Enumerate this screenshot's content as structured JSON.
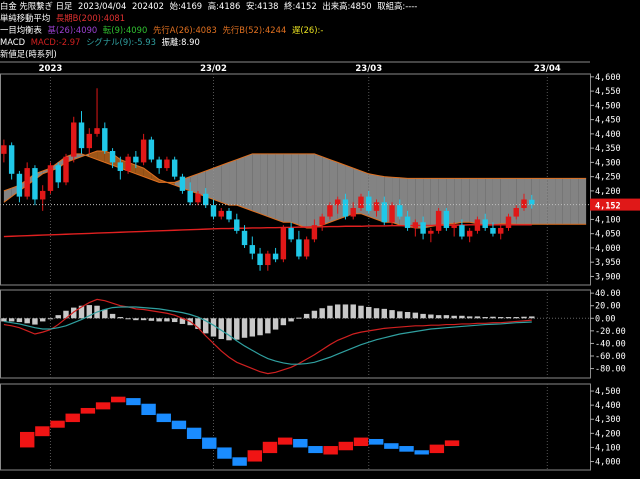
{
  "header": {
    "line1": {
      "instrument": "白金 先限繋ぎ 日足",
      "date": "2023/04/04",
      "contract": "202402",
      "open": "始:4169",
      "high": "高:4186",
      "low": "安:4138",
      "close": "終:4152",
      "volume": "出来高:4850",
      "turnover": "取組高:----"
    },
    "line2": {
      "label": "単純移動平均",
      "ma": "長期B(200):4081",
      "ma_color": "#e03030"
    },
    "line3": {
      "label": "一目均衡表",
      "base": "基(26):4090",
      "base_color": "#9a40d0",
      "conv": "転(9):4090",
      "conv_color": "#30c030",
      "spanA": "先行A(26):4083",
      "spanA_color": "#e07020",
      "spanB": "先行B(52):4244",
      "spanB_color": "#e07020",
      "lag": "遅(26):-",
      "lag_color": "#e8e020"
    },
    "line4": {
      "label": "MACD",
      "macd": "MACD:-2.97",
      "macd_color": "#d02020",
      "signal": "シグナル(9):-5.93",
      "signal_color": "#30a0a0",
      "osc": "振離:8.90"
    },
    "line5": {
      "label": "新値足(時系列)"
    }
  },
  "date_axis": [
    {
      "label": "2023",
      "bar": 6
    },
    {
      "label": "23/02",
      "bar": 27
    },
    {
      "label": "23/03",
      "bar": 47
    },
    {
      "label": "23/04",
      "bar": 70
    }
  ],
  "panels": {
    "price": {
      "ticks": [
        "4,600",
        "4,550",
        "4,500",
        "4,450",
        "4,400",
        "4,350",
        "4,300",
        "4,250",
        "4,200",
        "4,150",
        "4,100",
        "4,050",
        "4,000",
        "3,950",
        "3,900"
      ],
      "current_label": "4,152",
      "current_value": 4152
    },
    "macd": {
      "ticks": [
        "40.00",
        "20.00",
        "0.00",
        "-20.00",
        "-40.00",
        "-60.00",
        "-80.00"
      ]
    },
    "shinne": {
      "ticks": [
        "4,500",
        "4,400",
        "4,300",
        "4,200",
        "4,100",
        "4,000"
      ]
    }
  },
  "colors": {
    "up": "#e01818",
    "down": "#20c8e8",
    "cloud_up": "#b8651c",
    "cloud_down": "#9a9a9a",
    "osc": "#c8c8c8",
    "blue": "#1a8cff",
    "red": "#f01414"
  },
  "chart_data": [
    {
      "type": "candlestick",
      "title": "白金 先限繋ぎ 日足",
      "y_range": [
        3870,
        4610
      ],
      "ohlc": [
        [
          4330,
          4380,
          4300,
          4360
        ],
        [
          4360,
          4370,
          4240,
          4260
        ],
        [
          4260,
          4270,
          4160,
          4180
        ],
        [
          4180,
          4300,
          4170,
          4280
        ],
        [
          4280,
          4290,
          4150,
          4170
        ],
        [
          4170,
          4220,
          4130,
          4200
        ],
        [
          4200,
          4300,
          4190,
          4290
        ],
        [
          4290,
          4300,
          4210,
          4230
        ],
        [
          4230,
          4330,
          4220,
          4320
        ],
        [
          4320,
          4460,
          4300,
          4440
        ],
        [
          4440,
          4480,
          4330,
          4350
        ],
        [
          4350,
          4420,
          4330,
          4400
        ],
        [
          4400,
          4560,
          4390,
          4420
        ],
        [
          4420,
          4440,
          4330,
          4340
        ],
        [
          4340,
          4350,
          4280,
          4300
        ],
        [
          4300,
          4320,
          4240,
          4270
        ],
        [
          4270,
          4330,
          4260,
          4320
        ],
        [
          4320,
          4340,
          4280,
          4300
        ],
        [
          4300,
          4400,
          4290,
          4380
        ],
        [
          4380,
          4390,
          4300,
          4310
        ],
        [
          4310,
          4320,
          4260,
          4280
        ],
        [
          4280,
          4320,
          4270,
          4310
        ],
        [
          4310,
          4320,
          4240,
          4250
        ],
        [
          4250,
          4260,
          4190,
          4200
        ],
        [
          4200,
          4230,
          4150,
          4160
        ],
        [
          4160,
          4200,
          4150,
          4190
        ],
        [
          4190,
          4210,
          4140,
          4150
        ],
        [
          4150,
          4170,
          4100,
          4110
        ],
        [
          4110,
          4140,
          4100,
          4130
        ],
        [
          4130,
          4140,
          4090,
          4100
        ],
        [
          4100,
          4120,
          4050,
          4060
        ],
        [
          4060,
          4080,
          4000,
          4010
        ],
        [
          4010,
          4040,
          3960,
          3980
        ],
        [
          3980,
          4000,
          3920,
          3940
        ],
        [
          3940,
          3990,
          3920,
          3980
        ],
        [
          3980,
          4000,
          3950,
          3960
        ],
        [
          3960,
          4080,
          3950,
          4070
        ],
        [
          4070,
          4090,
          4020,
          4030
        ],
        [
          4030,
          4060,
          3960,
          3970
        ],
        [
          3970,
          4040,
          3960,
          4030
        ],
        [
          4030,
          4100,
          4020,
          4080
        ],
        [
          4080,
          4120,
          4060,
          4110
        ],
        [
          4110,
          4160,
          4100,
          4150
        ],
        [
          4150,
          4180,
          4120,
          4170
        ],
        [
          4170,
          4190,
          4100,
          4110
        ],
        [
          4110,
          4160,
          4100,
          4140
        ],
        [
          4140,
          4190,
          4130,
          4180
        ],
        [
          4180,
          4200,
          4120,
          4130
        ],
        [
          4130,
          4170,
          4110,
          4160
        ],
        [
          4160,
          4180,
          4080,
          4090
        ],
        [
          4090,
          4160,
          4080,
          4150
        ],
        [
          4150,
          4170,
          4100,
          4110
        ],
        [
          4110,
          4130,
          4060,
          4070
        ],
        [
          4070,
          4100,
          4040,
          4090
        ],
        [
          4090,
          4110,
          4030,
          4050
        ],
        [
          4050,
          4070,
          4020,
          4060
        ],
        [
          4060,
          4140,
          4050,
          4130
        ],
        [
          4130,
          4140,
          4060,
          4070
        ],
        [
          4070,
          4090,
          4040,
          4080
        ],
        [
          4080,
          4100,
          4030,
          4040
        ],
        [
          4040,
          4070,
          4020,
          4060
        ],
        [
          4060,
          4110,
          4050,
          4100
        ],
        [
          4100,
          4120,
          4060,
          4070
        ],
        [
          4070,
          4090,
          4040,
          4050
        ],
        [
          4050,
          4080,
          4030,
          4070
        ],
        [
          4070,
          4120,
          4060,
          4110
        ],
        [
          4110,
          4150,
          4100,
          4140
        ],
        [
          4140,
          4190,
          4130,
          4170
        ],
        [
          4169,
          4186,
          4138,
          4152
        ]
      ],
      "ma200": [
        4040,
        4041,
        4042,
        4043,
        4044,
        4045,
        4046,
        4047,
        4048,
        4049,
        4050,
        4051,
        4052,
        4053,
        4054,
        4055,
        4056,
        4057,
        4058,
        4059,
        4060,
        4061,
        4062,
        4063,
        4064,
        4065,
        4066,
        4067,
        4068,
        4068,
        4069,
        4069,
        4070,
        4070,
        4071,
        4071,
        4072,
        4072,
        4073,
        4073,
        4074,
        4074,
        4075,
        4075,
        4076,
        4076,
        4076,
        4077,
        4077,
        4077,
        4078,
        4078,
        4078,
        4079,
        4079,
        4079,
        4080,
        4080,
        4080,
        4080,
        4081,
        4081,
        4081,
        4081,
        4081,
        4081,
        4081,
        4081,
        4081
      ],
      "cloud_spanA": [
        4160,
        4180,
        4200,
        4220,
        4240,
        4260,
        4270,
        4280,
        4300,
        4310,
        4320,
        4330,
        4340,
        4340,
        4330,
        4310,
        4300,
        4290,
        4280,
        4260,
        4240,
        4230,
        4220,
        4210,
        4200,
        4190,
        4180,
        4170,
        4160,
        4150,
        4150,
        4140,
        4130,
        4120,
        4110,
        4100,
        4090,
        4090,
        4080,
        4070,
        4070,
        4080,
        4090,
        4100,
        4110,
        4120,
        4120,
        4110,
        4100,
        4090,
        4090,
        4080,
        4075,
        4070,
        4070,
        4075,
        4080,
        4085,
        4085,
        4090,
        4090,
        4085,
        4080,
        4080,
        4085,
        4085,
        4083,
        4083,
        4083,
        4083,
        4083,
        4083,
        4083,
        4083,
        4083,
        4083
      ],
      "cloud_spanB": [
        4200,
        4210,
        4220,
        4240,
        4260,
        4270,
        4280,
        4300,
        4320,
        4330,
        4330,
        4320,
        4310,
        4300,
        4290,
        4280,
        4270,
        4260,
        4250,
        4240,
        4230,
        4230,
        4230,
        4240,
        4250,
        4260,
        4270,
        4280,
        4290,
        4300,
        4310,
        4320,
        4330,
        4330,
        4330,
        4330,
        4330,
        4330,
        4330,
        4330,
        4330,
        4320,
        4310,
        4300,
        4290,
        4280,
        4270,
        4260,
        4255,
        4250,
        4248,
        4246,
        4244,
        4244,
        4244,
        4244,
        4244,
        4244,
        4244,
        4244,
        4244,
        4244,
        4244,
        4244,
        4244,
        4244,
        4244,
        4244,
        4244,
        4244,
        4244,
        4244,
        4244,
        4244,
        4244,
        4244
      ]
    },
    {
      "type": "line",
      "title": "MACD",
      "y_range": [
        -95,
        45
      ],
      "macd": [
        -10,
        -12,
        -15,
        -20,
        -25,
        -22,
        -18,
        -10,
        0,
        10,
        18,
        25,
        30,
        28,
        24,
        20,
        18,
        15,
        14,
        12,
        10,
        8,
        5,
        0,
        -5,
        -15,
        -28,
        -40,
        -52,
        -62,
        -70,
        -75,
        -80,
        -85,
        -88,
        -86,
        -82,
        -78,
        -72,
        -65,
        -58,
        -50,
        -42,
        -35,
        -30,
        -25,
        -22,
        -20,
        -18,
        -16,
        -15,
        -14,
        -13,
        -12,
        -12,
        -11,
        -11,
        -10,
        -10,
        -9,
        -9,
        -8,
        -8,
        -7,
        -7,
        -6,
        -5,
        -4,
        -2.97
      ],
      "signal": [
        -5,
        -7,
        -9,
        -12,
        -15,
        -17,
        -17,
        -15,
        -12,
        -7,
        -2,
        4,
        10,
        14,
        17,
        18,
        18,
        18,
        17,
        16,
        15,
        13,
        11,
        9,
        6,
        2,
        -4,
        -11,
        -19,
        -27,
        -36,
        -44,
        -51,
        -58,
        -64,
        -68,
        -71,
        -73,
        -73,
        -72,
        -70,
        -66,
        -62,
        -57,
        -52,
        -47,
        -42,
        -38,
        -34,
        -31,
        -28,
        -25,
        -23,
        -21,
        -19,
        -17,
        -16,
        -15,
        -14,
        -13,
        -12,
        -11,
        -10,
        -9.5,
        -9,
        -8,
        -7,
        -6.5,
        -5.93
      ]
    },
    {
      "type": "bar",
      "title": "新値足(時系列)",
      "y_range": [
        3940,
        4550
      ],
      "bricks": [
        [
          0,
          4100,
          4210,
          "red"
        ],
        [
          1,
          4180,
          4250,
          "red"
        ],
        [
          2,
          4240,
          4290,
          "red"
        ],
        [
          3,
          4280,
          4340,
          "red"
        ],
        [
          4,
          4340,
          4380,
          "red"
        ],
        [
          5,
          4370,
          4420,
          "red"
        ],
        [
          6,
          4420,
          4460,
          "red"
        ],
        [
          7,
          4400,
          4450,
          "blue"
        ],
        [
          8,
          4330,
          4410,
          "blue"
        ],
        [
          9,
          4280,
          4340,
          "blue"
        ],
        [
          10,
          4230,
          4290,
          "blue"
        ],
        [
          11,
          4160,
          4240,
          "blue"
        ],
        [
          12,
          4090,
          4170,
          "blue"
        ],
        [
          13,
          4020,
          4100,
          "blue"
        ],
        [
          14,
          3970,
          4030,
          "blue"
        ],
        [
          15,
          4000,
          4080,
          "red"
        ],
        [
          16,
          4060,
          4140,
          "red"
        ],
        [
          17,
          4120,
          4170,
          "red"
        ],
        [
          18,
          4100,
          4160,
          "blue"
        ],
        [
          19,
          4060,
          4110,
          "blue"
        ],
        [
          20,
          4050,
          4110,
          "red"
        ],
        [
          21,
          4080,
          4140,
          "red"
        ],
        [
          22,
          4110,
          4170,
          "red"
        ],
        [
          23,
          4120,
          4160,
          "blue"
        ],
        [
          24,
          4090,
          4130,
          "blue"
        ],
        [
          25,
          4070,
          4110,
          "blue"
        ],
        [
          26,
          4050,
          4080,
          "blue"
        ],
        [
          27,
          4060,
          4120,
          "red"
        ],
        [
          28,
          4110,
          4150,
          "red"
        ]
      ]
    }
  ]
}
